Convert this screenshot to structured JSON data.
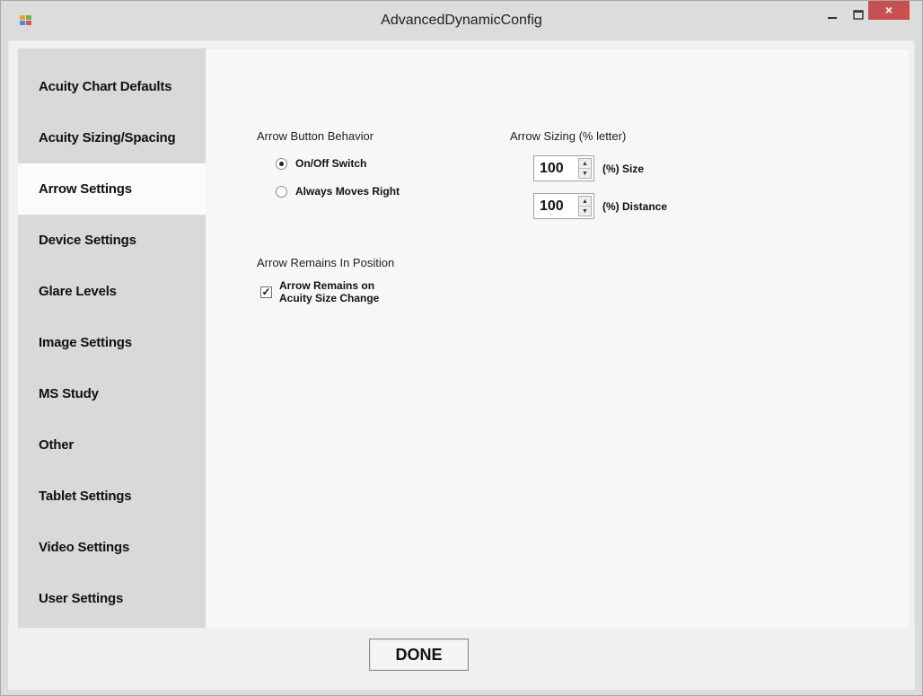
{
  "window": {
    "title": "AdvancedDynamicConfig",
    "close_glyph": "×",
    "accent_close_color": "#c75050"
  },
  "tabs": [
    {
      "label": "Acuity Chart Defaults",
      "selected": false
    },
    {
      "label": "Acuity Sizing/Spacing",
      "selected": false
    },
    {
      "label": "Arrow Settings",
      "selected": true
    },
    {
      "label": "Device Settings",
      "selected": false
    },
    {
      "label": "Glare Levels",
      "selected": false
    },
    {
      "label": "Image Settings",
      "selected": false
    },
    {
      "label": "MS Study",
      "selected": false
    },
    {
      "label": "Other",
      "selected": false
    },
    {
      "label": "Tablet Settings",
      "selected": false
    },
    {
      "label": "Video Settings",
      "selected": false
    },
    {
      "label": "User Settings",
      "selected": false
    }
  ],
  "arrow_button_behavior": {
    "label": "Arrow Button Behavior",
    "options": [
      {
        "label": "On/Off Switch",
        "checked": true
      },
      {
        "label": "Always Moves Right",
        "checked": false
      }
    ]
  },
  "arrow_remains": {
    "label": "Arrow Remains In Position",
    "checkbox_label_line1": "Arrow Remains on",
    "checkbox_label_line2": "Acuity Size Change",
    "checked": true,
    "check_glyph": "✓"
  },
  "arrow_sizing": {
    "label": "Arrow Sizing (% letter)",
    "size_value": "100",
    "size_label": "(%) Size",
    "distance_value": "100",
    "distance_label": "(%) Distance",
    "up_glyph": "▲",
    "down_glyph": "▼"
  },
  "footer": {
    "done_label": "DONE"
  }
}
